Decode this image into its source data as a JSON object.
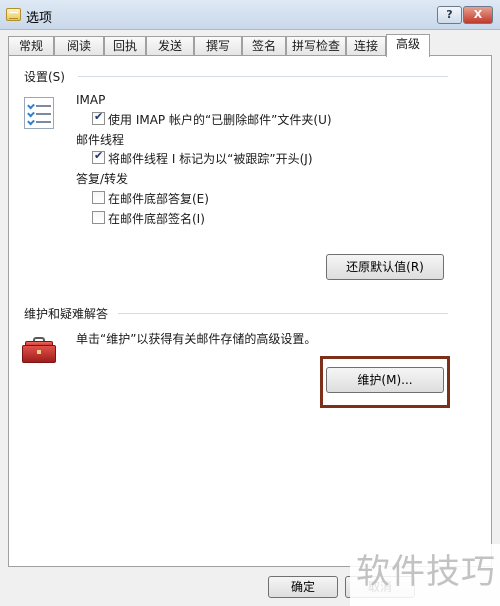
{
  "window": {
    "title": "选项",
    "help_label": "?",
    "close_label": "X"
  },
  "tabs": [
    {
      "label": "常规"
    },
    {
      "label": "阅读"
    },
    {
      "label": "回执"
    },
    {
      "label": "发送"
    },
    {
      "label": "撰写"
    },
    {
      "label": "签名"
    },
    {
      "label": "拼写检查"
    },
    {
      "label": "连接"
    },
    {
      "label": "高级",
      "active": true
    }
  ],
  "settings": {
    "title": "设置(S)",
    "imap": {
      "label": "IMAP",
      "option": {
        "label": "使用 IMAP 帐户的“已删除邮件”文件夹(U)",
        "checked": true
      }
    },
    "threads": {
      "label": "邮件线程",
      "option": {
        "label": "将邮件线程 I 标记为以“被跟踪”开头(J)",
        "checked": true
      }
    },
    "reply": {
      "label": "答复/转发",
      "options": [
        {
          "label": "在邮件底部答复(E)",
          "checked": false
        },
        {
          "label": "在邮件底部签名(I)",
          "checked": false
        }
      ]
    },
    "restore_button": "还原默认值(R)"
  },
  "maintenance": {
    "title": "维护和疑难解答",
    "description": "单击“维护”以获得有关邮件存储的高级设置。",
    "button": "维护(M)..."
  },
  "footer": {
    "ok": "确定",
    "cancel": "取消"
  },
  "watermark": "软件技巧",
  "colors": {
    "highlight": "#7d2f1a",
    "panel": "#ffffff",
    "window": "#f0f0f0"
  }
}
